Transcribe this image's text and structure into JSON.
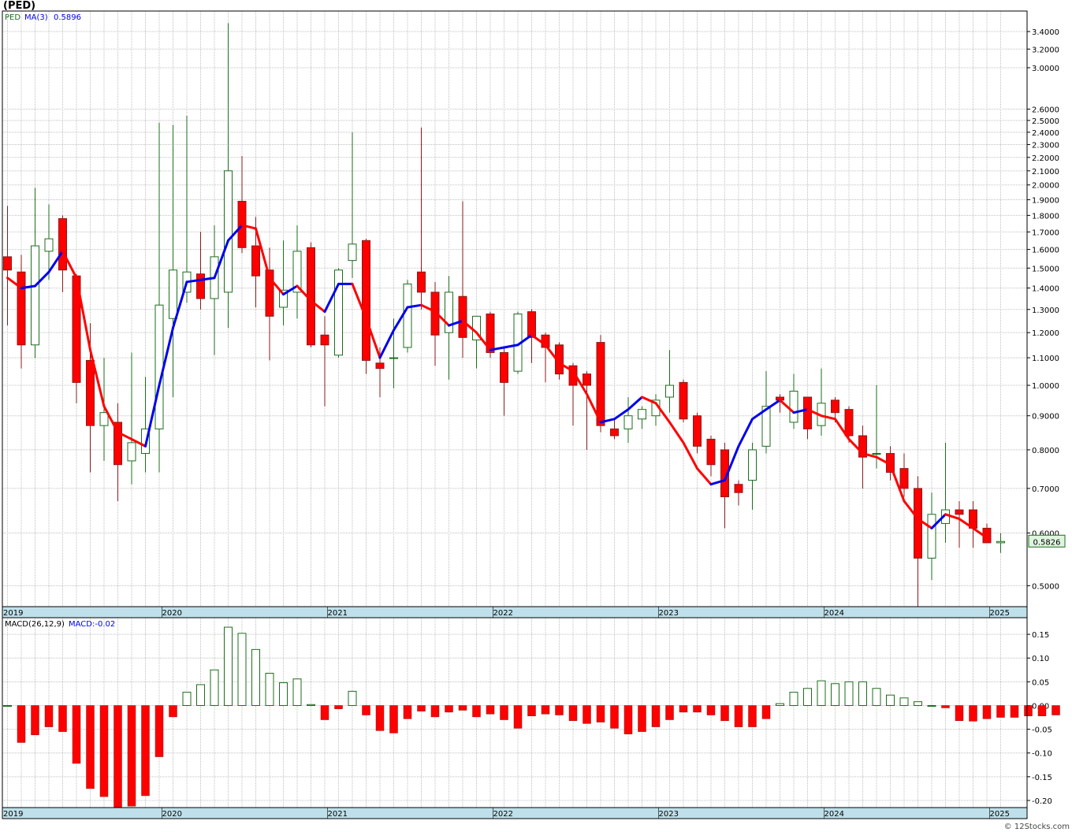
{
  "header": {
    "title": "(PED)",
    "watermark": "© 12Stocks.com"
  },
  "legend": {
    "symbol": "PED",
    "ma_label": "MA(3)",
    "ma_value": "0.5896",
    "macd_label": "MACD(26,12,9)",
    "macd_value": "MACD:-0.02",
    "last_price": "0.5826"
  },
  "colors": {
    "up": "#1c6e1c",
    "down": "#ff0000",
    "ma_up": "#0000ee",
    "ma_down": "#ff0000",
    "axis_band": "#bfe0ea",
    "grid": "#c0c0c0"
  },
  "chart_data": [
    {
      "type": "candlestick",
      "scale": "log",
      "ylim": [
        0.465,
        3.65
      ],
      "y_ticks": [
        "0.5000",
        "0.6000",
        "0.7000",
        "0.8000",
        "0.9000",
        "1.0000",
        "1.1000",
        "1.2000",
        "1.3000",
        "1.4000",
        "1.5000",
        "1.6000",
        "1.7000",
        "1.8000",
        "1.9000",
        "2.0000",
        "2.1000",
        "2.2000",
        "2.3000",
        "2.4000",
        "2.5000",
        "2.6000",
        "3.0000",
        "3.2000",
        "3.4000"
      ],
      "x_labels": [
        "2019",
        "2020",
        "2021",
        "2022",
        "2023",
        "2024",
        "2025"
      ],
      "x_label_months": [
        0,
        12,
        24,
        36,
        48,
        60,
        72
      ],
      "start": "2019-08",
      "ohlc": [
        [
          1.56,
          1.86,
          1.23,
          1.49
        ],
        [
          1.48,
          1.57,
          1.06,
          1.15
        ],
        [
          1.15,
          1.98,
          1.1,
          1.62
        ],
        [
          1.59,
          1.87,
          1.44,
          1.66
        ],
        [
          1.78,
          1.8,
          1.38,
          1.49
        ],
        [
          1.46,
          1.47,
          0.94,
          1.01
        ],
        [
          1.09,
          1.24,
          0.74,
          0.87
        ],
        [
          0.87,
          1.1,
          0.77,
          0.91
        ],
        [
          0.88,
          0.94,
          0.67,
          0.76
        ],
        [
          0.77,
          1.12,
          0.71,
          0.82
        ],
        [
          0.79,
          1.03,
          0.74,
          0.86
        ],
        [
          0.86,
          2.48,
          0.74,
          1.32
        ],
        [
          1.26,
          2.46,
          0.96,
          1.49
        ],
        [
          1.38,
          2.54,
          1.33,
          1.48
        ],
        [
          1.47,
          1.7,
          1.3,
          1.35
        ],
        [
          1.35,
          1.74,
          1.11,
          1.56
        ],
        [
          1.38,
          3.5,
          1.22,
          2.1
        ],
        [
          1.89,
          2.21,
          1.58,
          1.61
        ],
        [
          1.62,
          1.79,
          1.31,
          1.46
        ],
        [
          1.49,
          1.61,
          1.09,
          1.27
        ],
        [
          1.31,
          1.65,
          1.23,
          1.39
        ],
        [
          1.38,
          1.74,
          1.26,
          1.59
        ],
        [
          1.61,
          1.64,
          1.14,
          1.15
        ],
        [
          1.19,
          1.27,
          0.93,
          1.15
        ],
        [
          1.11,
          1.5,
          1.1,
          1.49
        ],
        [
          1.54,
          2.4,
          1.45,
          1.63
        ],
        [
          1.65,
          1.66,
          1.04,
          1.09
        ],
        [
          1.08,
          1.14,
          0.96,
          1.06
        ],
        [
          1.1,
          1.26,
          0.99,
          1.1
        ],
        [
          1.14,
          1.44,
          1.12,
          1.42
        ],
        [
          1.48,
          2.44,
          1.3,
          1.38
        ],
        [
          1.38,
          1.43,
          1.07,
          1.19
        ],
        [
          1.2,
          1.46,
          1.02,
          1.38
        ],
        [
          1.36,
          1.89,
          1.1,
          1.18
        ],
        [
          1.17,
          1.27,
          1.06,
          1.27
        ],
        [
          1.28,
          1.29,
          1.1,
          1.12
        ],
        [
          1.12,
          1.14,
          0.9,
          1.01
        ],
        [
          1.05,
          1.29,
          1.04,
          1.28
        ],
        [
          1.29,
          1.3,
          1.08,
          1.18
        ],
        [
          1.19,
          1.2,
          1.01,
          1.14
        ],
        [
          1.15,
          1.16,
          1.02,
          1.04
        ],
        [
          1.07,
          1.08,
          0.87,
          1.0
        ],
        [
          1.04,
          1.05,
          0.8,
          1.0
        ],
        [
          1.16,
          1.19,
          0.85,
          0.87
        ],
        [
          0.86,
          0.89,
          0.83,
          0.84
        ],
        [
          0.86,
          0.96,
          0.82,
          0.9
        ],
        [
          0.89,
          0.93,
          0.86,
          0.92
        ],
        [
          0.9,
          0.97,
          0.87,
          0.95
        ],
        [
          0.96,
          1.13,
          0.91,
          1.0
        ],
        [
          1.01,
          1.02,
          0.88,
          0.89
        ],
        [
          0.9,
          0.91,
          0.79,
          0.81
        ],
        [
          0.83,
          0.84,
          0.73,
          0.76
        ],
        [
          0.8,
          0.82,
          0.61,
          0.68
        ],
        [
          0.71,
          0.72,
          0.66,
          0.69
        ],
        [
          0.72,
          0.82,
          0.65,
          0.8
        ],
        [
          0.81,
          1.05,
          0.79,
          0.93
        ],
        [
          0.96,
          0.97,
          0.91,
          0.95
        ],
        [
          0.88,
          1.04,
          0.86,
          0.98
        ],
        [
          0.96,
          0.96,
          0.83,
          0.86
        ],
        [
          0.87,
          1.06,
          0.84,
          0.94
        ],
        [
          0.95,
          0.96,
          0.88,
          0.91
        ],
        [
          0.92,
          0.93,
          0.82,
          0.84
        ],
        [
          0.84,
          0.87,
          0.7,
          0.78
        ],
        [
          0.79,
          1.0,
          0.75,
          0.79
        ],
        [
          0.79,
          0.81,
          0.72,
          0.74
        ],
        [
          0.75,
          0.79,
          0.68,
          0.7
        ],
        [
          0.7,
          0.73,
          0.46,
          0.55
        ],
        [
          0.55,
          0.69,
          0.51,
          0.64
        ],
        [
          0.62,
          0.82,
          0.58,
          0.65
        ],
        [
          0.65,
          0.67,
          0.57,
          0.64
        ],
        [
          0.65,
          0.67,
          0.57,
          0.61
        ],
        [
          0.61,
          0.62,
          0.58,
          0.58
        ],
        [
          0.58,
          0.6,
          0.56,
          0.5826
        ]
      ],
      "ma3": [
        1.45,
        1.4,
        1.41,
        1.48,
        1.59,
        1.45,
        1.13,
        0.93,
        0.85,
        0.83,
        0.81,
        1.0,
        1.22,
        1.43,
        1.44,
        1.45,
        1.65,
        1.74,
        1.72,
        1.45,
        1.37,
        1.41,
        1.34,
        1.29,
        1.42,
        1.42,
        1.26,
        1.1,
        1.21,
        1.31,
        1.32,
        1.29,
        1.23,
        1.25,
        1.2,
        1.13,
        1.14,
        1.15,
        1.19,
        1.15,
        1.08,
        1.05,
        0.97,
        0.88,
        0.89,
        0.92,
        0.96,
        0.94,
        0.88,
        0.82,
        0.75,
        0.71,
        0.72,
        0.81,
        0.89,
        0.92,
        0.95,
        0.91,
        0.92,
        0.9,
        0.89,
        0.83,
        0.79,
        0.78,
        0.76,
        0.67,
        0.63,
        0.61,
        0.64,
        0.63,
        0.61,
        0.59
      ]
    },
    {
      "type": "bar",
      "title": "MACD(26,12,9)",
      "ylim": [
        -0.215,
        0.185
      ],
      "y_ticks": [
        "0.15",
        "0.10",
        "0.05",
        "0.00",
        "-0.05",
        "-0.10",
        "-0.15",
        "-0.20"
      ],
      "values": [
        0.0,
        -0.078,
        -0.062,
        -0.045,
        -0.055,
        -0.122,
        -0.175,
        -0.192,
        -0.214,
        -0.212,
        -0.19,
        -0.108,
        -0.024,
        0.028,
        0.044,
        0.075,
        0.165,
        0.152,
        0.118,
        0.068,
        0.048,
        0.056,
        0.002,
        -0.03,
        -0.007,
        0.03,
        -0.02,
        -0.053,
        -0.058,
        -0.028,
        -0.012,
        -0.024,
        -0.014,
        -0.01,
        -0.024,
        -0.018,
        -0.03,
        -0.048,
        -0.022,
        -0.018,
        -0.02,
        -0.032,
        -0.038,
        -0.035,
        -0.048,
        -0.06,
        -0.055,
        -0.045,
        -0.03,
        -0.014,
        -0.014,
        -0.02,
        -0.032,
        -0.045,
        -0.045,
        -0.028,
        0.004,
        0.028,
        0.036,
        0.052,
        0.046,
        0.05,
        0.05,
        0.036,
        0.022,
        0.016,
        0.008,
        0.0,
        -0.005,
        -0.032,
        -0.033,
        -0.028,
        -0.025,
        -0.025,
        -0.022,
        -0.022,
        -0.02
      ]
    }
  ]
}
